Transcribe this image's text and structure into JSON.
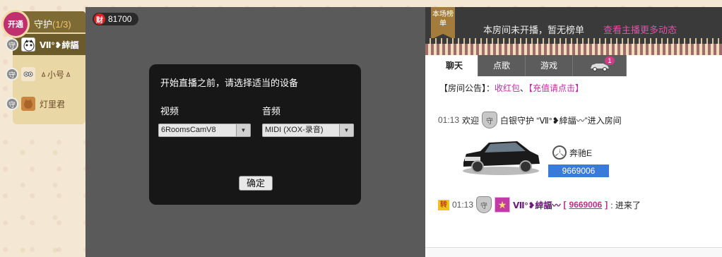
{
  "guard": {
    "open_label": "开通",
    "title": "守护",
    "count": "(1/3)",
    "badge_label": "守",
    "members": [
      {
        "name": "Ⅶ°❥緈諨",
        "active": true
      },
      {
        "name": "ㅿ小号ㅿ",
        "active": false
      },
      {
        "name": "灯里君",
        "active": false
      }
    ]
  },
  "video": {
    "wealth_icon": "财",
    "wealth_value": "81700",
    "dialog": {
      "title": "开始直播之前，请选择适当的设备",
      "video_label": "视频",
      "audio_label": "音频",
      "video_device": "6RoomsCamV8",
      "audio_device": "MIDI (XOX-录音)",
      "confirm": "确定"
    }
  },
  "ranking": {
    "tag": "本场榜单",
    "empty_text": "本房间未开播，暂无榜单",
    "more_link": "查看主播更多动态"
  },
  "chat": {
    "tabs": [
      "聊天",
      "点歌",
      "游戏"
    ],
    "car_badge": "1",
    "announcement": {
      "prefix": "【房间公告】：",
      "link1": "收红包",
      "sep": "、",
      "link2": "【充值请点击】"
    },
    "msg1": {
      "time": "01:13",
      "welcome": "欢迎",
      "shield": "守",
      "text": "白银守护 “Ⅶ°❥緈諨〰”进入房间"
    },
    "car": {
      "brand": "奔驰E",
      "id": "9669006"
    },
    "msg2": {
      "transfer": "转",
      "time": "01:13",
      "shield": "守",
      "star": "★",
      "username": "Ⅶ°❥緈諨〰",
      "uid": "9669006",
      "bracket_open": " [",
      "bracket_close": "]",
      "text": ": 进来了"
    }
  },
  "colors": {
    "accent_pink": "#c02ca0",
    "guard_gold": "#7e6a34",
    "dialog_bg": "#171717",
    "video_bg": "#5a5a5a"
  }
}
